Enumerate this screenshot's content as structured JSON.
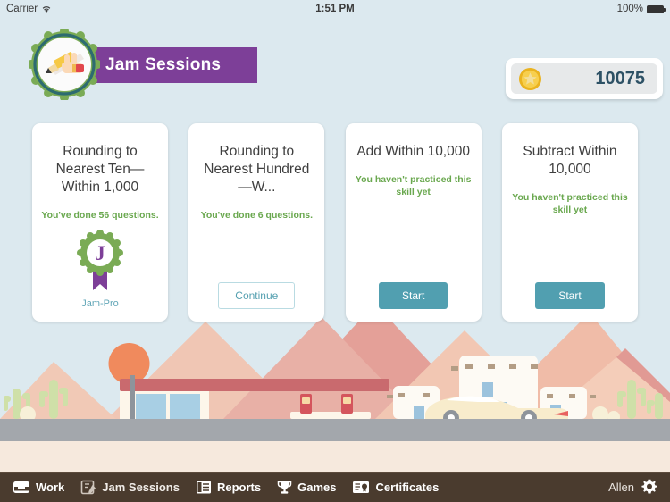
{
  "statusbar": {
    "carrier": "Carrier",
    "wifi_icon": "wifi-icon",
    "time": "1:51 PM",
    "battery_pct": "100%",
    "battery_icon": "battery-full-icon"
  },
  "header": {
    "title": "Jam Sessions",
    "logo_icon": "pencil-hand-badge-icon",
    "ribbon_color": "#7d3f98",
    "coins": {
      "value": "10075",
      "icon": "star-coin-icon"
    }
  },
  "cards": [
    {
      "title": "Rounding to Nearest Ten—Within 1,000",
      "status": "You've done 56 questions.",
      "state": "mastered",
      "badge_icon": "jam-pro-rosette-icon",
      "badge_letter": "J",
      "badge_label": "Jam-Pro",
      "action_label": ""
    },
    {
      "title": "Rounding to Nearest Hundred—W...",
      "status": "You've done 6 questions.",
      "state": "in-progress",
      "badge_icon": "",
      "badge_letter": "",
      "badge_label": "",
      "action_label": "Continue"
    },
    {
      "title": "Add Within 10,000",
      "status": "You haven't practiced this skill yet",
      "state": "not-started",
      "badge_icon": "",
      "badge_letter": "",
      "badge_label": "",
      "action_label": "Start"
    },
    {
      "title": "Subtract Within 10,000",
      "status": "You haven't practiced this skill yet",
      "state": "not-started",
      "badge_icon": "",
      "badge_letter": "",
      "badge_label": "",
      "action_label": "Start"
    }
  ],
  "navbar": {
    "items": [
      {
        "label": "Work",
        "icon": "inbox-tray-icon",
        "active": true
      },
      {
        "label": "Jam Sessions",
        "icon": "note-pencil-icon",
        "active": false
      },
      {
        "label": "Reports",
        "icon": "checklist-icon",
        "active": false
      },
      {
        "label": "Games",
        "icon": "trophy-icon",
        "active": false
      },
      {
        "label": "Certificates",
        "icon": "certificate-icon",
        "active": false
      }
    ],
    "user": "Allen",
    "settings_icon": "gear-icon"
  },
  "theme": {
    "background": "#dce9ef",
    "accent_teal": "#519fb0",
    "accent_purple": "#7d3f98",
    "accent_green": "#6aa84f",
    "navbar": "#4a3b2e",
    "ground": "#f6e9dd",
    "road": "#a3a7ac"
  }
}
